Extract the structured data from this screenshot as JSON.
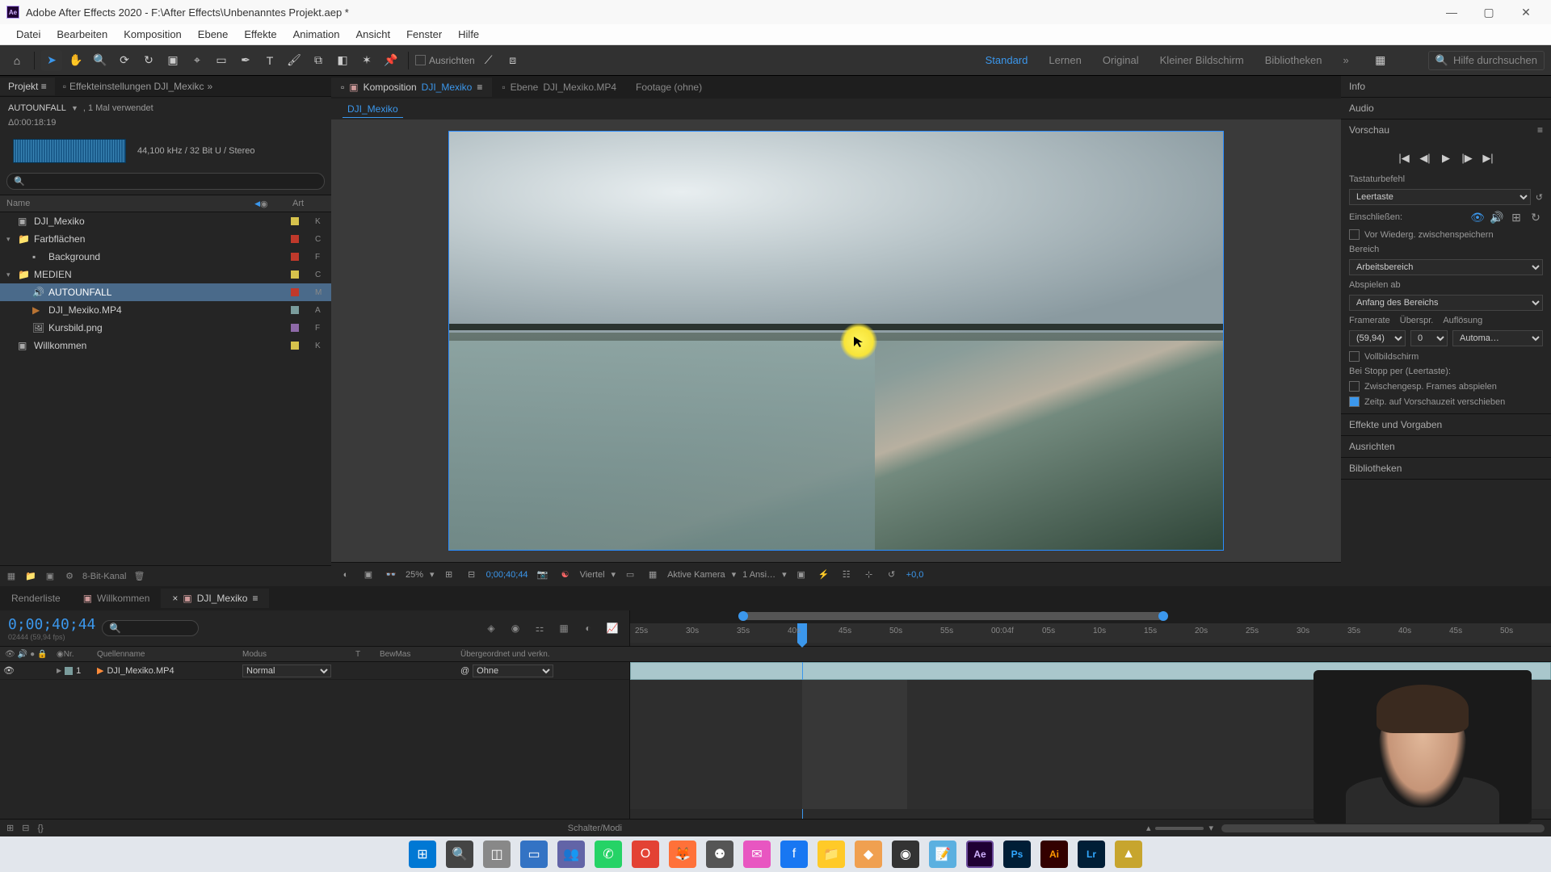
{
  "titlebar": {
    "app_icon_text": "Ae",
    "title": "Adobe After Effects 2020 - F:\\After Effects\\Unbenanntes Projekt.aep *"
  },
  "menu": [
    "Datei",
    "Bearbeiten",
    "Komposition",
    "Ebene",
    "Effekte",
    "Animation",
    "Ansicht",
    "Fenster",
    "Hilfe"
  ],
  "toolbar": {
    "ausrichten": "Ausrichten",
    "workspaces": [
      "Standard",
      "Lernen",
      "Original",
      "Kleiner Bildschirm",
      "Bibliotheken"
    ],
    "workspace_current": "Standard",
    "search_placeholder": "Hilfe durchsuchen"
  },
  "project_panel": {
    "tab_project": "Projekt",
    "tab_effectcontrols": "Effekteinstellungen DJI_Mexikc",
    "asset_name": "AUTOUNFALL",
    "asset_used": ", 1 Mal verwendet",
    "asset_dur": "Δ0:00:18:19",
    "audio_spec": "44,100 kHz / 32 Bit U / Stereo",
    "search_ph": "",
    "col_name": "Name",
    "col_art": "Art",
    "tree": [
      {
        "indent": 0,
        "twist": "",
        "icon": "comp",
        "label": "DJI_Mexiko",
        "swatch": "#d6c24c",
        "art": "K"
      },
      {
        "indent": 0,
        "twist": "▾",
        "icon": "folder",
        "label": "Farbflächen",
        "swatch": "#c0392b",
        "art": "C"
      },
      {
        "indent": 1,
        "twist": "",
        "icon": "solid",
        "label": "Background",
        "swatch": "#c0392b",
        "art": "F"
      },
      {
        "indent": 0,
        "twist": "▾",
        "icon": "folder",
        "label": "MEDIEN",
        "swatch": "#d6c24c",
        "art": "C"
      },
      {
        "indent": 1,
        "twist": "",
        "icon": "audio",
        "label": "AUTOUNFALL",
        "swatch": "#c0392b",
        "art": "M",
        "selected": true
      },
      {
        "indent": 1,
        "twist": "",
        "icon": "video",
        "label": "DJI_Mexiko.MP4",
        "swatch": "#7a9c9c",
        "art": "A"
      },
      {
        "indent": 1,
        "twist": "",
        "icon": "image",
        "label": "Kursbild.png",
        "swatch": "#8e6aa8",
        "art": "F"
      },
      {
        "indent": 0,
        "twist": "",
        "icon": "comp",
        "label": "Willkommen",
        "swatch": "#d6c24c",
        "art": "K"
      }
    ],
    "footer_depth": "8-Bit-Kanal"
  },
  "center": {
    "tabs": {
      "comp_prefix": "Komposition",
      "comp_name": "DJI_Mexiko",
      "layer_prefix": "Ebene",
      "layer_name": "DJI_Mexiko.MP4",
      "footage": "Footage (ohne)"
    },
    "subtab": "DJI_Mexiko",
    "footer": {
      "zoom": "25%",
      "tc": "0;00;40;44",
      "res": "Viertel",
      "camera": "Aktive Kamera",
      "views": "1 Ansi…",
      "exposure": "+0,0"
    }
  },
  "right": {
    "info": "Info",
    "audio": "Audio",
    "vorschau": "Vorschau",
    "tastatur": "Tastaturbefehl",
    "shortcut_val": "Leertaste",
    "einschliessen": "Einschließen:",
    "cache": "Vor Wiederg. zwischenspeichern",
    "bereich": "Bereich",
    "bereich_val": "Arbeitsbereich",
    "abspielen": "Abspielen ab",
    "abspielen_val": "Anfang des Bereichs",
    "framerate": "Framerate",
    "framerate_val": "(59,94)",
    "uberspr": "Überspr.",
    "uberspr_val": "0",
    "aufl": "Auflösung",
    "aufl_val": "Automa…",
    "vollbild": "Vollbildschirm",
    "stopp": "Bei Stopp per (Leertaste):",
    "zwframes": "Zwischengesp. Frames abspielen",
    "zeitp": "Zeitp. auf Vorschauzeit verschieben",
    "effekte": "Effekte und Vorgaben",
    "ausrichten": "Ausrichten",
    "biblio": "Bibliotheken"
  },
  "timeline": {
    "tab_render": "Renderliste",
    "tab_welcome": "Willkommen",
    "tab_comp": "DJI_Mexiko",
    "tc": "0;00;40;44",
    "tc_sub": "02444 (59,94 fps)",
    "cols": {
      "nr": "Nr.",
      "name": "Quellenname",
      "mode": "Modus",
      "t": "T",
      "bm": "BewMas",
      "parent": "Übergeordnet und verkn."
    },
    "layer1": {
      "nr": "1",
      "name": "DJI_Mexiko.MP4",
      "mode": "Normal",
      "parent": "Ohne"
    },
    "ruler": [
      "25s",
      "30s",
      "35s",
      "40s",
      "45s",
      "50s",
      "55s",
      "00:04f",
      "05s",
      "10s",
      "15s",
      "20s",
      "25s",
      "30s",
      "35s",
      "40s",
      "45s",
      "50s"
    ],
    "footer_mid": "Schalter/Modi"
  },
  "colors": {
    "ae": "#9999ff",
    "ps": "#31a8ff",
    "ai": "#ff9a00",
    "lr": "#31a8ff"
  }
}
